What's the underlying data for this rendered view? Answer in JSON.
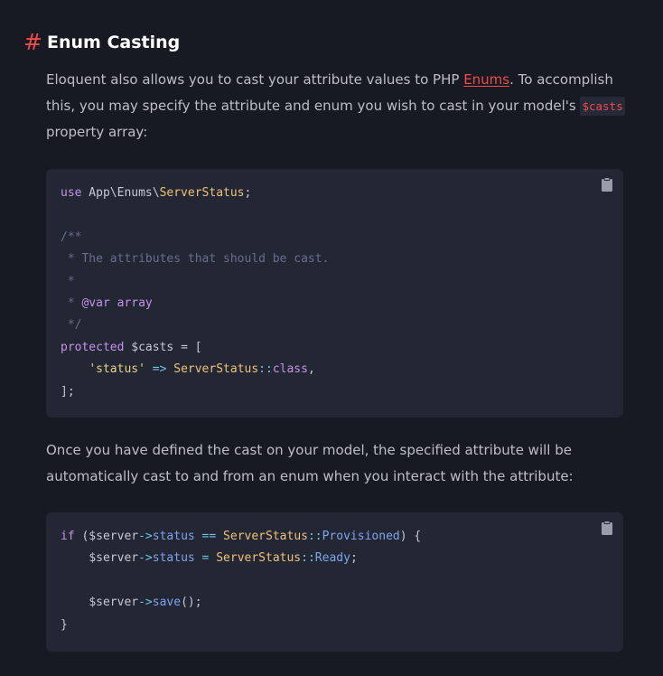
{
  "section": {
    "hash": "#",
    "title": "Enum Casting"
  },
  "intro": {
    "before_link": "Eloquent also allows you to cast your attribute values to PHP ",
    "link": "Enums",
    "after_link": ". To accomplish this, you may specify the attribute and enum you wish to cast in your model's ",
    "inline_code": "$casts",
    "after_code": " property array:"
  },
  "code1": {
    "copy_icon": "clipboard-icon",
    "l1": {
      "a": "use",
      "b": " App\\Enums\\",
      "c": "ServerStatus",
      "d": ";"
    },
    "l3": "/**",
    "l4": " * The attributes that should be cast.",
    "l5": " *",
    "l6": {
      "a": " * ",
      "b": "@var",
      "c": " array"
    },
    "l7": " */",
    "l8": {
      "a": "protected",
      "b": " $casts = ["
    },
    "l9": {
      "indent": "    ",
      "a": "'status'",
      "b": " => ",
      "c": "ServerStatus",
      "d": "::",
      "e": "class",
      "f": ","
    },
    "l10": "];"
  },
  "middle": {
    "text": "Once you have defined the cast on your model, the specified attribute will be automatically cast to and from an enum when you interact with the attribute:"
  },
  "code2": {
    "copy_icon": "clipboard-icon",
    "l1": {
      "a": "if",
      "b": " ($server",
      "c": "->",
      "d": "status",
      "e": " == ",
      "f": "ServerStatus",
      "g": "::",
      "h": "Provisioned",
      "i": ") {"
    },
    "l2": {
      "indent": "    ",
      "a": "$server",
      "b": "->",
      "c": "status",
      "d": " = ",
      "e": "ServerStatus",
      "f": "::",
      "g": "Ready",
      "h": ";"
    },
    "l4": {
      "indent": "    ",
      "a": "$server",
      "b": "->",
      "c": "save",
      "d": "();"
    },
    "l5": "}"
  },
  "colors": {
    "background": "#171923",
    "code_background": "#232633",
    "accent": "#ef4b4b"
  }
}
